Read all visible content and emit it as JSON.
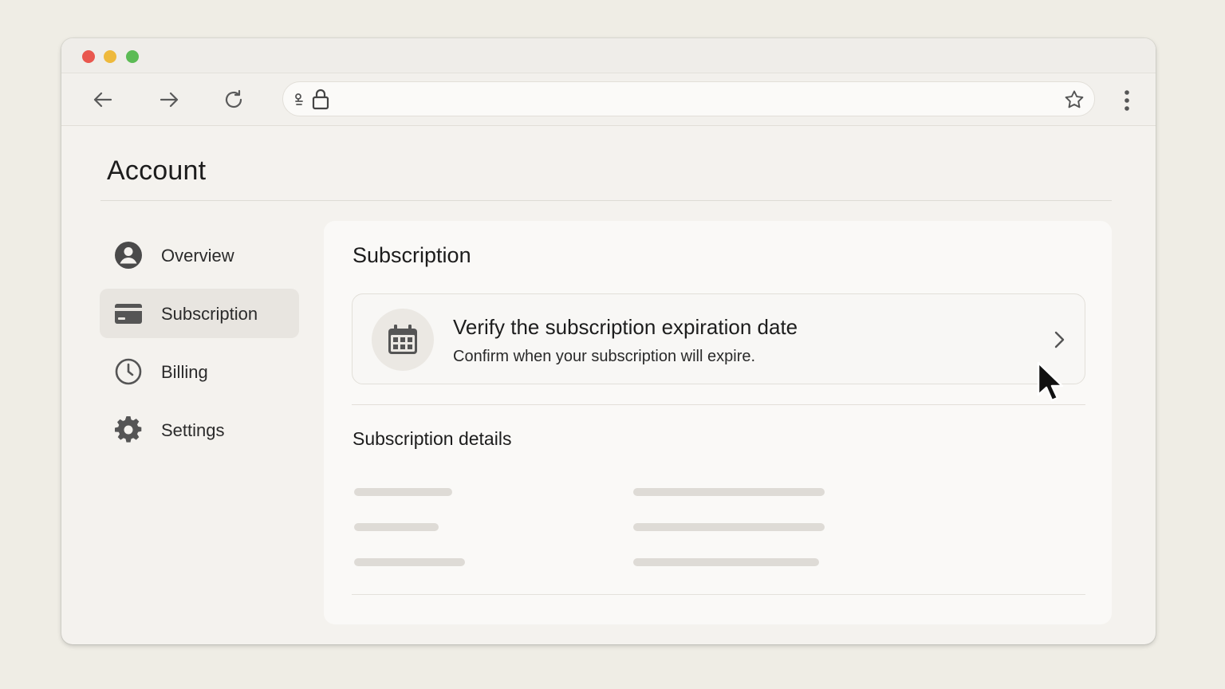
{
  "browser": {
    "address_text": ""
  },
  "page": {
    "title": "Account"
  },
  "sidebar": {
    "items": [
      {
        "label": "Overview",
        "icon": "user-circle-icon",
        "active": false
      },
      {
        "label": "Subscription",
        "icon": "credit-card-icon",
        "active": true
      },
      {
        "label": "Billing",
        "icon": "clock-icon",
        "active": false
      },
      {
        "label": "Settings",
        "icon": "gear-icon",
        "active": false
      }
    ]
  },
  "panel": {
    "title": "Subscription",
    "task_card": {
      "icon": "calendar-icon",
      "title": "Verify the subscription expiration date",
      "subtitle": "Confirm when your subscription will expire."
    },
    "details_title": "Subscription details"
  },
  "colors": {
    "background": "#efede5",
    "window": "#f4f2ee",
    "active_item": "#e8e5e0",
    "traffic_red": "#e9574e",
    "traffic_yellow": "#eeb93c",
    "traffic_green": "#5cbb55"
  }
}
